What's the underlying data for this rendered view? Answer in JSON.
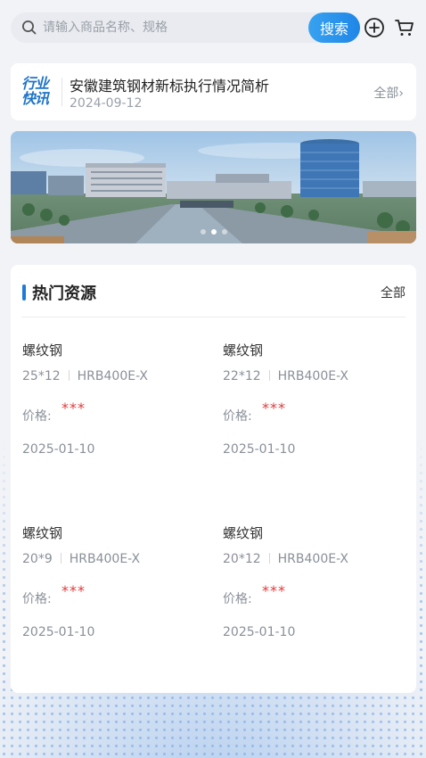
{
  "search": {
    "placeholder": "请输入商品名称、规格",
    "button_label": "搜索"
  },
  "icons": {
    "search": "search-icon",
    "add": "plus-circle-icon",
    "cart": "cart-icon"
  },
  "news": {
    "logo_line1": "行业",
    "logo_line2": "快讯",
    "title": "安徽建筑钢材新标执行情况简析",
    "date": "2024-09-12",
    "all_label": "全部",
    "chevron": "›"
  },
  "banner": {
    "slide_count": 3,
    "active_index": 1
  },
  "hot": {
    "title": "热门资源",
    "all_label": "全部",
    "price_label": "价格:",
    "items": [
      {
        "name": "螺纹钢",
        "size": "25*12",
        "grade": "HRB400E-X",
        "price": "***",
        "date": "2025-01-10"
      },
      {
        "name": "螺纹钢",
        "size": "22*12",
        "grade": "HRB400E-X",
        "price": "***",
        "date": "2025-01-10"
      },
      {
        "name": "螺纹钢",
        "size": "20*9",
        "grade": "HRB400E-X",
        "price": "***",
        "date": "2025-01-10"
      },
      {
        "name": "螺纹钢",
        "size": "20*12",
        "grade": "HRB400E-X",
        "price": "***",
        "date": "2025-01-10"
      }
    ]
  },
  "colors": {
    "accent": "#1f86e6",
    "price": "#e03a3a",
    "page_bg": "#f1f3f7"
  }
}
